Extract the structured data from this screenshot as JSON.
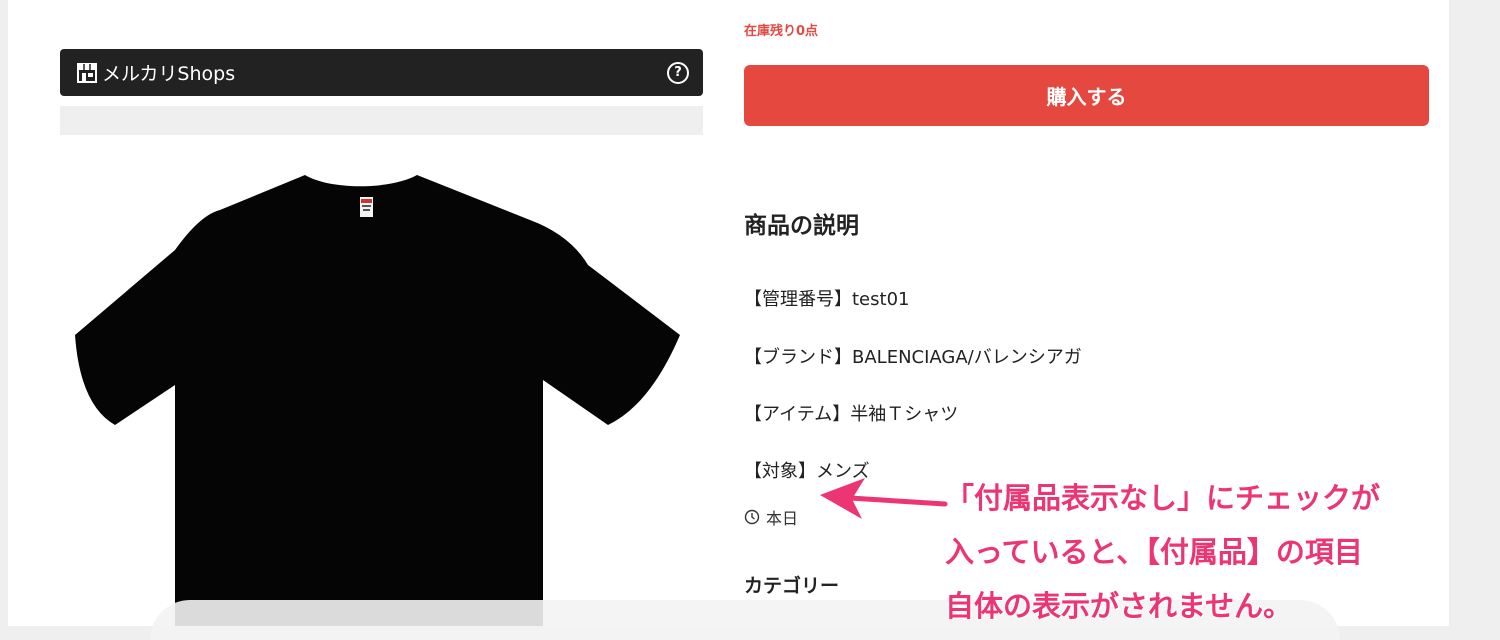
{
  "shops": {
    "name": "メルカリShops"
  },
  "product": {
    "stock_text": "在庫残り0点",
    "buy_label": "購入する",
    "description_title": "商品の説明",
    "description_lines": [
      "【管理番号】test01",
      "【ブランド】BALENCIAGA/バレンシアガ",
      "【アイテム】半袖Ｔシャツ",
      "【対象】メンズ"
    ],
    "posted": "本日",
    "category_title": "カテゴリー"
  },
  "annotation": {
    "lines": [
      "「付属品表示なし」にチェックが",
      "入っていると、【付属品】の項目",
      "自体の表示がされません。"
    ],
    "color": "#ec3573"
  },
  "colors": {
    "accent": "#e4483f",
    "stock": "#e24a43",
    "bar": "#222222"
  },
  "icons": {
    "store": "store-icon",
    "help": "help-icon",
    "clock": "clock-icon",
    "arrow": "arrow-left-icon"
  }
}
